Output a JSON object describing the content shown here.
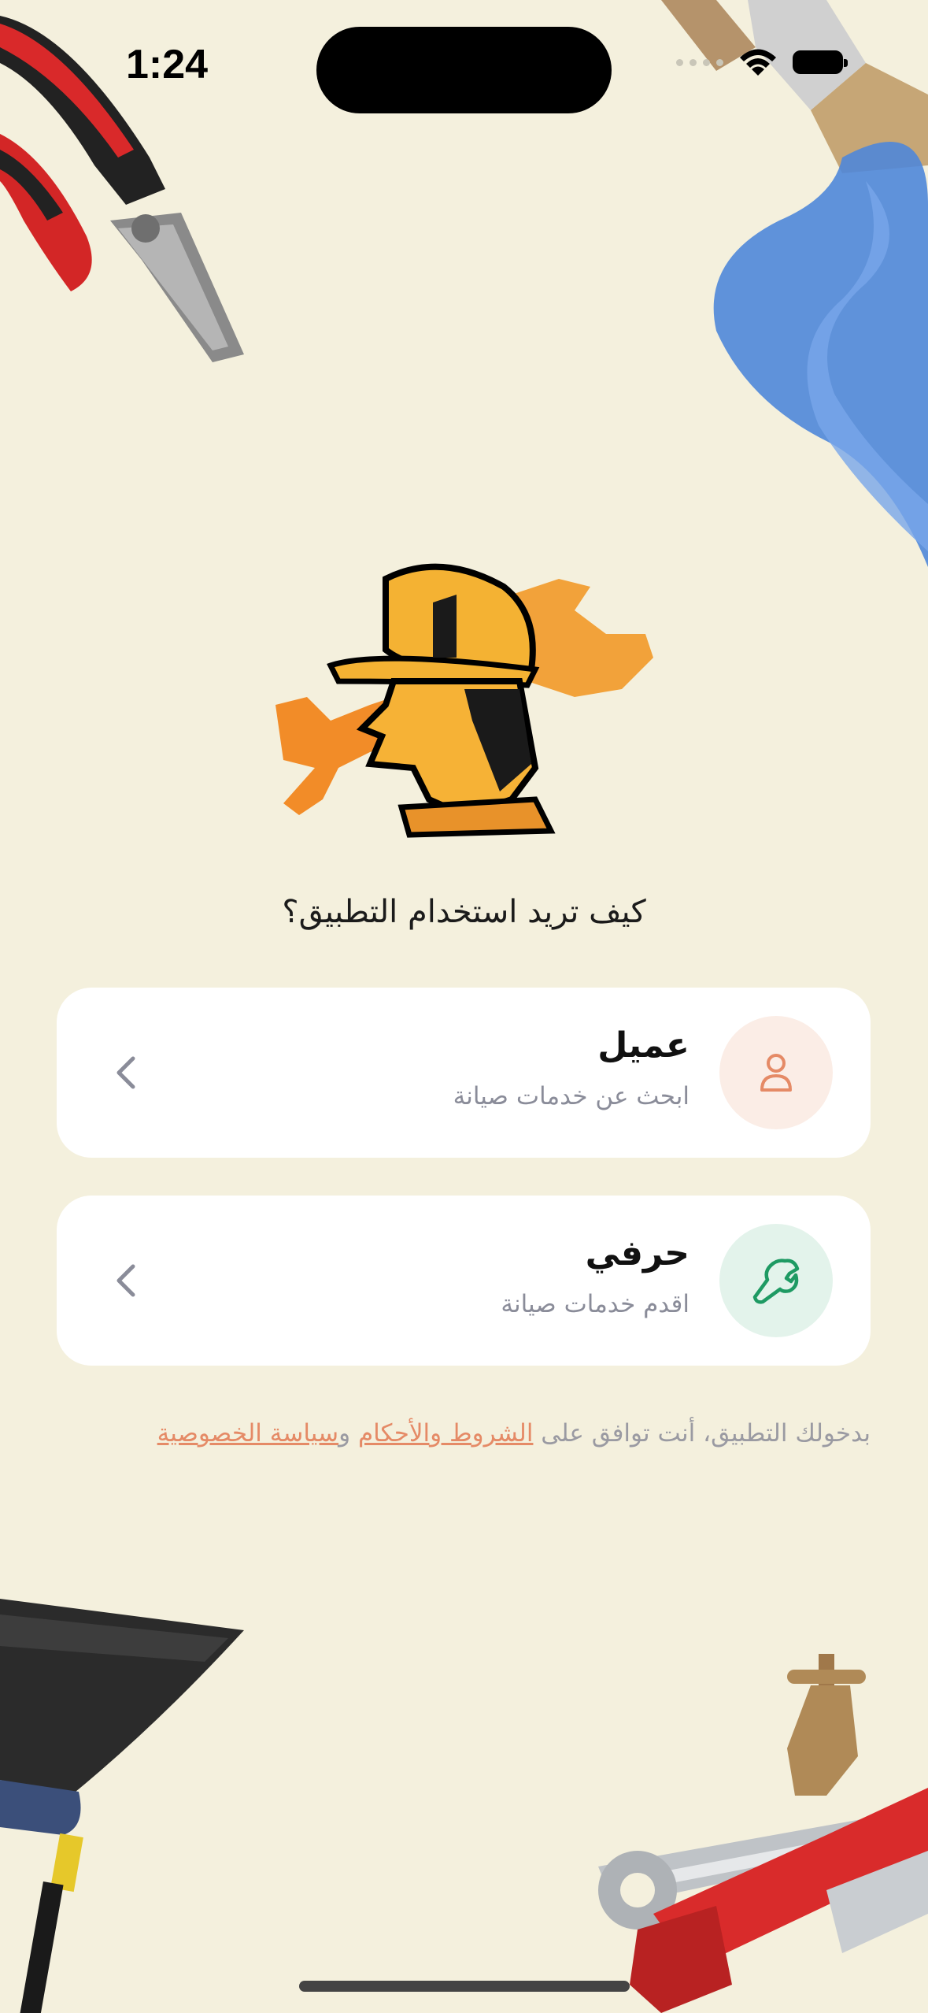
{
  "status_bar": {
    "time": "1:24"
  },
  "question": "كيف تريد استخدام التطبيق؟",
  "options": [
    {
      "title": "عميل",
      "subtitle": "ابحث عن خدمات صيانة",
      "icon": "person-icon",
      "icon_bg": "#FBEDE6",
      "icon_color": "#E58A66"
    },
    {
      "title": "حرفي",
      "subtitle": "اقدم خدمات صيانة",
      "icon": "wrench-icon",
      "icon_bg": "#E3F3EB",
      "icon_color": "#1E9A63"
    }
  ],
  "terms": {
    "prefix": "بدخولك التطبيق، أنت توافق على ",
    "terms_link": "الشروط والأحكام",
    "and": " و",
    "privacy_link": "سياسة الخصوصية"
  },
  "colors": {
    "background": "#F4F0DD",
    "card": "#FFFFFF",
    "accent": "#E58A66"
  }
}
